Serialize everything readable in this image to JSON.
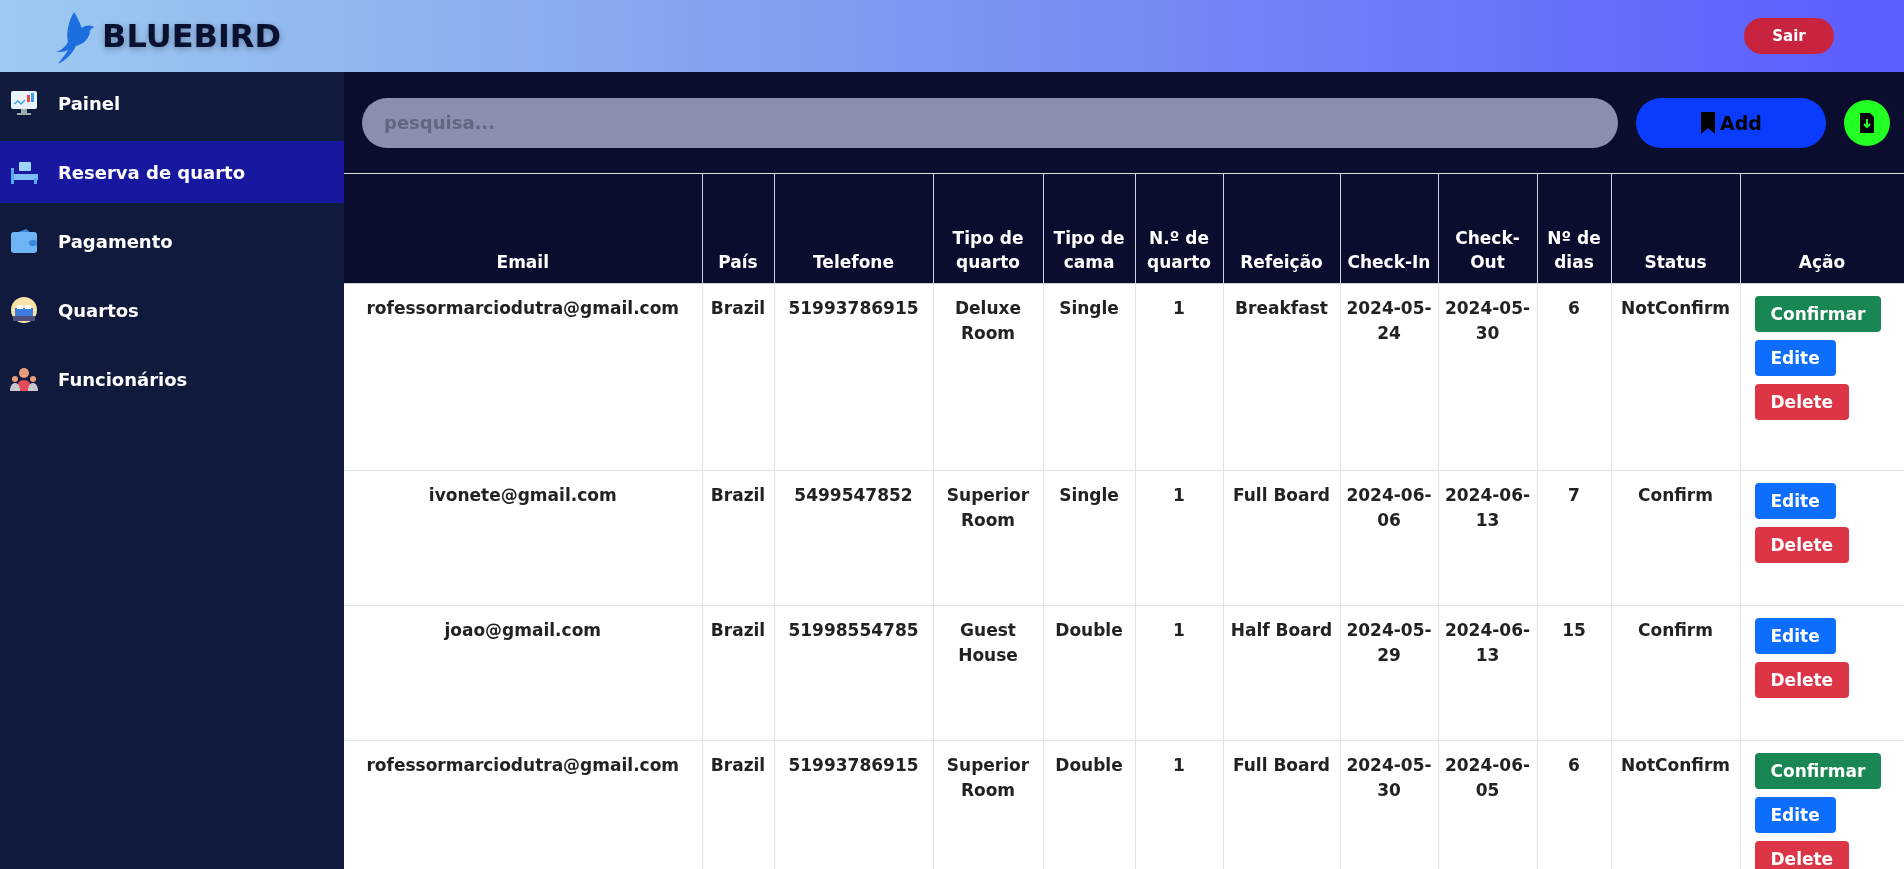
{
  "header": {
    "brand": "BLUEBIRD",
    "logout_button": "Sair"
  },
  "sidebar": {
    "items": [
      {
        "label": "Painel",
        "selected": false
      },
      {
        "label": "Reserva de quarto",
        "selected": true
      },
      {
        "label": "Pagamento",
        "selected": false
      },
      {
        "label": "Quartos",
        "selected": false
      },
      {
        "label": "Funcionários",
        "selected": false
      }
    ]
  },
  "toolbar": {
    "search": {
      "placeholder": "pesquisa..."
    },
    "add_button": "Add"
  },
  "table": {
    "columns": [
      "Email",
      "País",
      "Telefone",
      "Tipo de quarto",
      "Tipo de cama",
      "N.º de quarto",
      "Refeição",
      "Check-In",
      "Check-Out",
      "Nº de dias",
      "Status",
      "Ação"
    ],
    "rows": [
      {
        "cells": [
          "rofessormarciodutra@gmail.com",
          "Brazil",
          "51993786915",
          "Deluxe Room",
          "Single",
          "1",
          "Breakfast",
          "2024-05-24",
          "2024-05-30",
          "6",
          "NotConfirm"
        ],
        "actions": [
          {
            "kind": "confirm",
            "label": "Confirmar"
          },
          {
            "kind": "edit",
            "label": "Edite"
          },
          {
            "kind": "delete",
            "label": "Delete"
          }
        ]
      },
      {
        "cells": [
          "ivonete@gmail.com",
          "Brazil",
          "5499547852",
          "Superior Room",
          "Single",
          "1",
          "Full Board",
          "2024-06-06",
          "2024-06-13",
          "7",
          "Confirm"
        ],
        "actions": [
          {
            "kind": "edit",
            "label": "Edite"
          },
          {
            "kind": "delete",
            "label": "Delete"
          }
        ]
      },
      {
        "cells": [
          "joao@gmail.com",
          "Brazil",
          "51998554785",
          "Guest House",
          "Double",
          "1",
          "Half Board",
          "2024-05-29",
          "2024-06-13",
          "15",
          "Confirm"
        ],
        "actions": [
          {
            "kind": "edit",
            "label": "Edite"
          },
          {
            "kind": "delete",
            "label": "Delete"
          }
        ]
      },
      {
        "cells": [
          "rofessormarciodutra@gmail.com",
          "Brazil",
          "51993786915",
          "Superior Room",
          "Double",
          "1",
          "Full Board",
          "2024-05-30",
          "2024-06-05",
          "6",
          "NotConfirm"
        ],
        "actions": [
          {
            "kind": "confirm",
            "label": "Confirmar"
          },
          {
            "kind": "edit",
            "label": "Edite"
          },
          {
            "kind": "delete",
            "label": "Delete"
          }
        ]
      }
    ]
  }
}
